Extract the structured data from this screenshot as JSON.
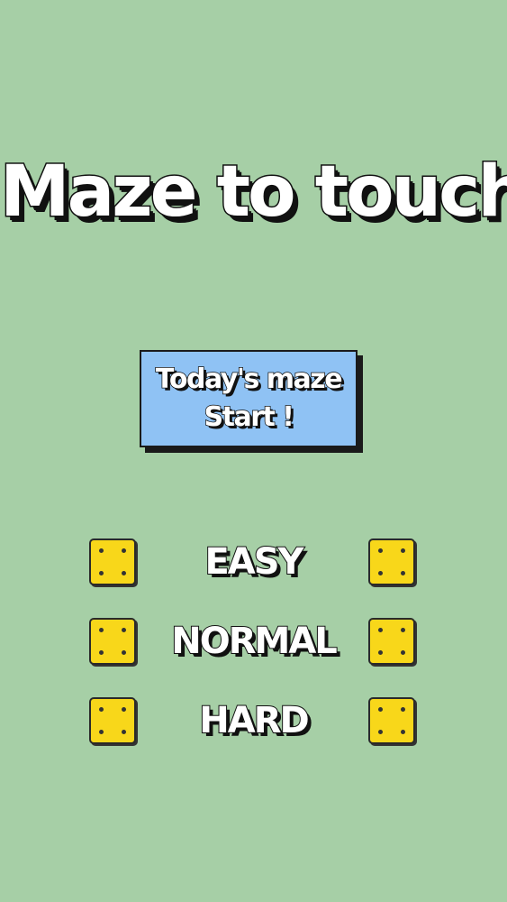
{
  "title": "Maze to touch",
  "start_button": {
    "line1": "Today's maze",
    "line2": "Start !"
  },
  "difficulties": [
    "EASY",
    "NORMAL",
    "HARD"
  ],
  "colors": {
    "background": "#a6cfa6",
    "start_button": "#8fc2f4",
    "die": "#f8d71a"
  },
  "icons": {
    "die": "die-four-icon"
  }
}
